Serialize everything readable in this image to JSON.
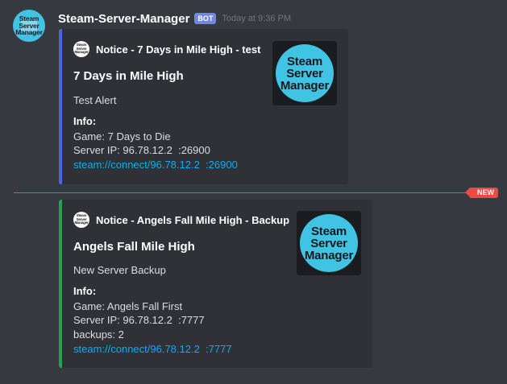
{
  "message": {
    "username": "Steam-Server-Manager",
    "bot_tag": "BOT",
    "timestamp": "Today at 9:36 PM",
    "avatar_logo": "Steam Server Manager"
  },
  "embeds": [
    {
      "accent_color": "#4a66de",
      "author": "Notice - 7 Days in Mile High - test",
      "title": "7 Days in Mile High",
      "description": "Test Alert",
      "field_name": "Info:",
      "lines": [
        "Game: 7 Days to Die",
        "Server IP: 96.78.12.2  :26900"
      ],
      "link": "steam://connect/96.78.12.2  :26900",
      "thumbnail_logo": "Steam Server Manager"
    },
    {
      "accent_color": "#2aa04c",
      "author": "Notice - Angels Fall Mile High - Backup",
      "title": "Angels Fall Mile High",
      "description": "New Server Backup",
      "field_name": "Info:",
      "lines": [
        "Game: Angels Fall First",
        "Server IP: 96.78.12.2  :7777",
        "backups: 2"
      ],
      "link": "steam://connect/96.78.12.2  :7777",
      "thumbnail_logo": "Steam Server Manager"
    }
  ],
  "divider": {
    "badge": "NEW",
    "color": "#f04747"
  },
  "icons": {
    "avatar": "steam-server-manager-logo-icon",
    "embed_author": "steam-server-manager-logo-icon",
    "thumbnail": "steam-server-manager-logo-icon"
  }
}
